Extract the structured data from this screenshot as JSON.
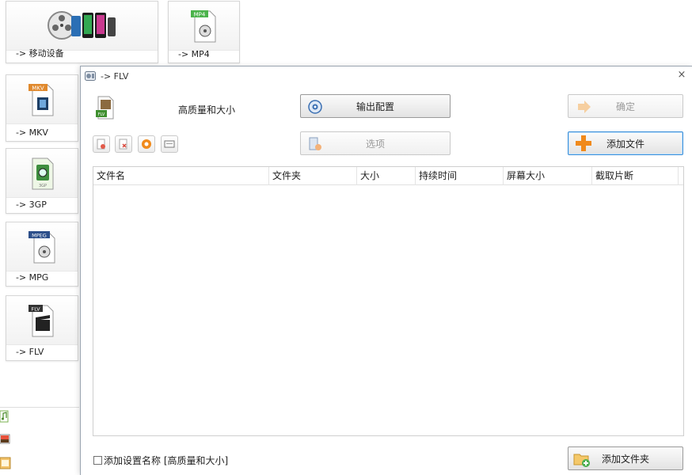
{
  "background": {
    "tiles": [
      {
        "label": "-> 移动设备"
      },
      {
        "label": "-> MP4",
        "badge": "MP4"
      },
      {
        "label": "-> MKV",
        "badge": "MKV"
      },
      {
        "label": "-> 3GP",
        "badge": "3GP"
      },
      {
        "label": "-> MPG",
        "badge": "MPEG"
      },
      {
        "label": "-> FLV",
        "badge": "FLV"
      }
    ]
  },
  "dialog": {
    "title": "-> FLV",
    "close_glyph": "×",
    "profile": {
      "name": "高质量和大小",
      "badge": "FLV"
    },
    "buttons": {
      "output_config": "输出配置",
      "confirm": "确定",
      "options": "选项",
      "add_file": "添加文件",
      "add_folder": "添加文件夹"
    },
    "list": {
      "columns": [
        "文件名",
        "文件夹",
        "大小",
        "持续时间",
        "屏幕大小",
        "截取片断"
      ],
      "rows": []
    },
    "checkbox": {
      "label": "添加设置名称 [高质量和大小]",
      "checked": false
    }
  },
  "colors": {
    "accent_blue": "#3c8fd8",
    "add_orange": "#f08a1c"
  }
}
